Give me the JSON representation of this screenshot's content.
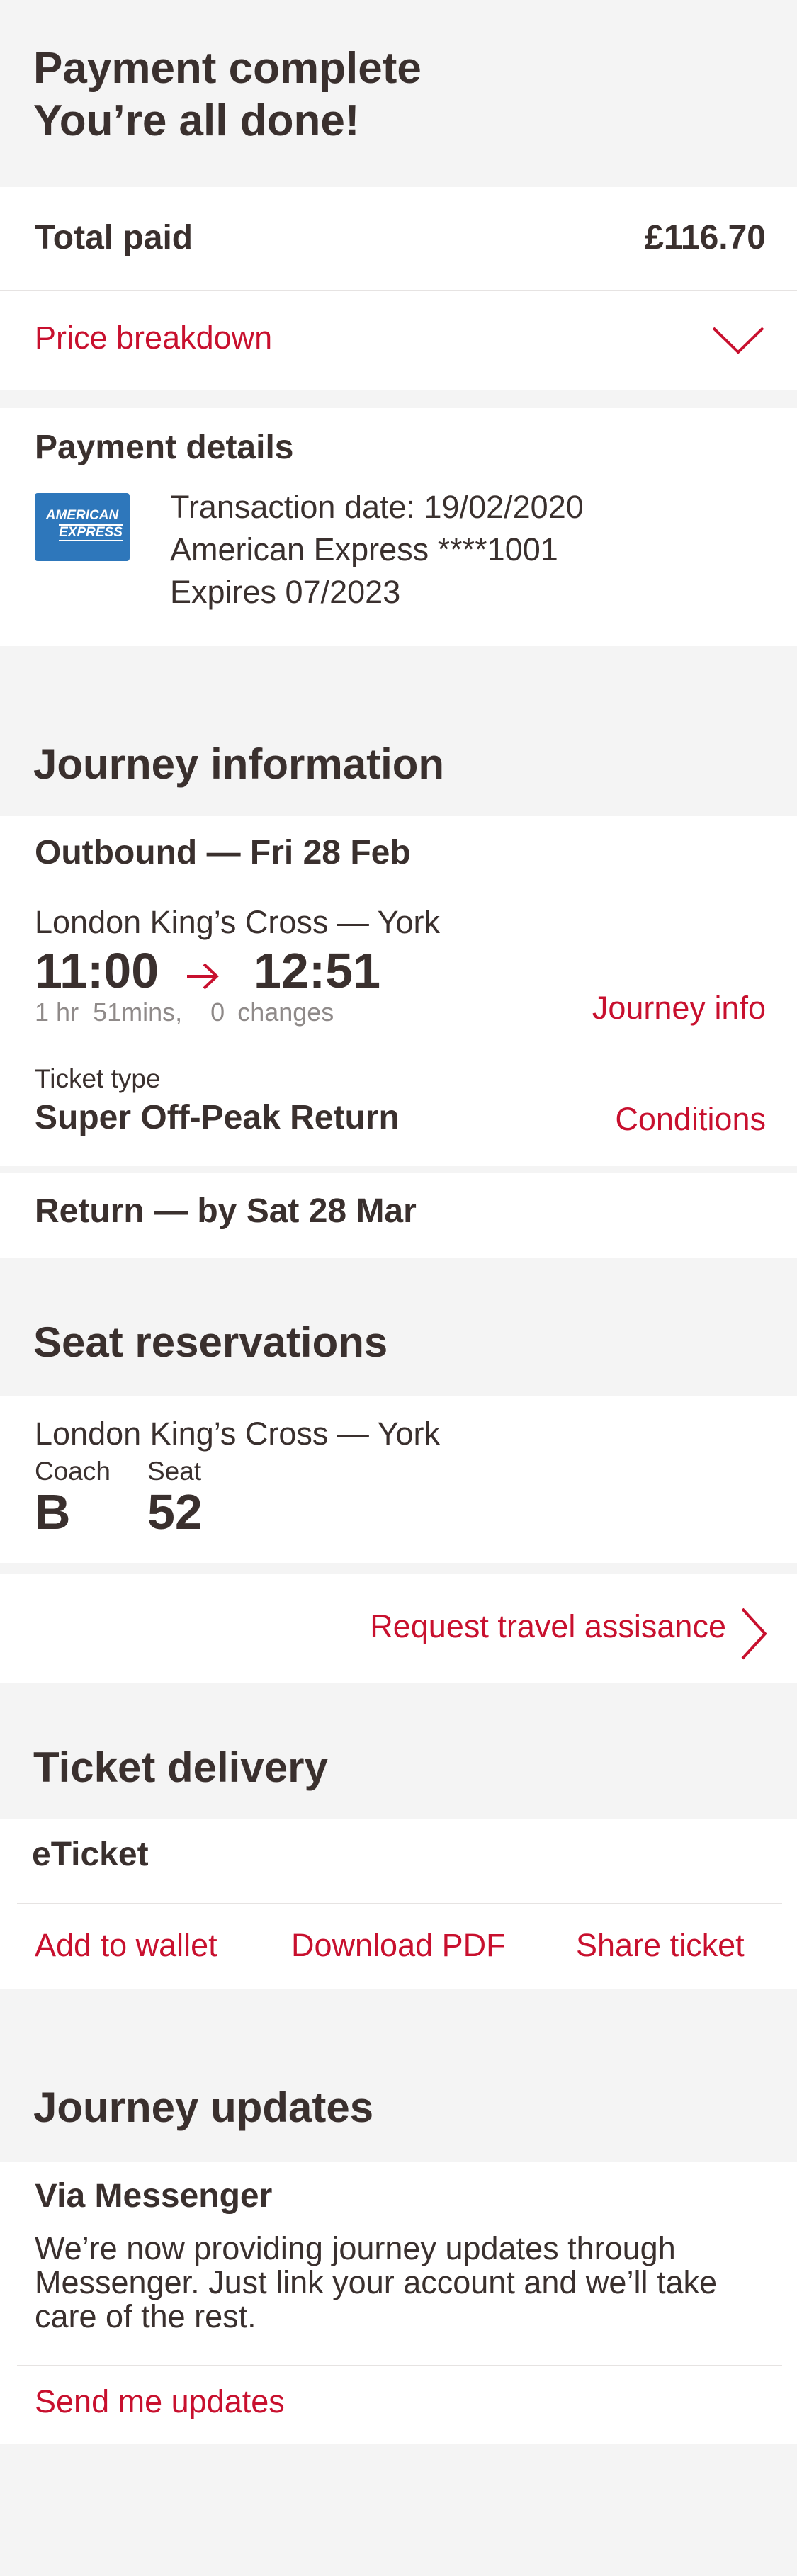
{
  "header": {
    "title_line1": "Payment complete",
    "title_line2": "You’re all done!"
  },
  "total": {
    "label": "Total paid",
    "amount": "£116.70"
  },
  "price_breakdown": {
    "label": "Price breakdown",
    "icon": "chevron-down-icon"
  },
  "payment": {
    "heading": "Payment details",
    "card_logo_line1": "AMERICAN",
    "card_logo_line2": "EXPRESS",
    "transaction_date": "Transaction date: 19/02/2020",
    "card": "American Express ****1001",
    "expires": "Expires 07/2023",
    "brand_color": "#2e77bb"
  },
  "journey": {
    "heading": "Journey information",
    "outbound_title": "Outbound — Fri 28 Feb",
    "route": "London King’s Cross — York",
    "depart": "11:00",
    "arrive": "12:51",
    "arrow_icon": "arrow-right-icon",
    "hours": "1",
    "hours_unit": "hr",
    "minutes": "51",
    "minutes_unit": "mins,",
    "changes": "0",
    "changes_unit": "changes",
    "journey_info_link": "Journey info",
    "ticket_type_label": "Ticket type",
    "ticket_type": "Super Off-Peak Return",
    "conditions_link": "Conditions",
    "return_title": "Return — by Sat 28 Mar"
  },
  "seats": {
    "heading": "Seat reservations",
    "route": "London King’s Cross — York",
    "coach_label": "Coach",
    "coach": "B",
    "seat_label": "Seat",
    "seat": "52",
    "assistance_link": "Request travel assisance",
    "assistance_icon": "chevron-right-icon"
  },
  "delivery": {
    "heading": "Ticket delivery",
    "type": "eTicket",
    "add_wallet": "Add to wallet",
    "download_pdf": "Download PDF",
    "share_ticket": "Share ticket"
  },
  "updates": {
    "heading": "Journey updates",
    "via": "Via Messenger",
    "line1": "We’re now providing journey updates through",
    "line2": "Messenger. Just link your account and we’ll take",
    "line3": "care of the rest.",
    "send_link": "Send me updates"
  },
  "colors": {
    "accent": "#c8102e",
    "text": "#3a302e",
    "background": "#f4f4f4",
    "card": "#ffffff"
  }
}
